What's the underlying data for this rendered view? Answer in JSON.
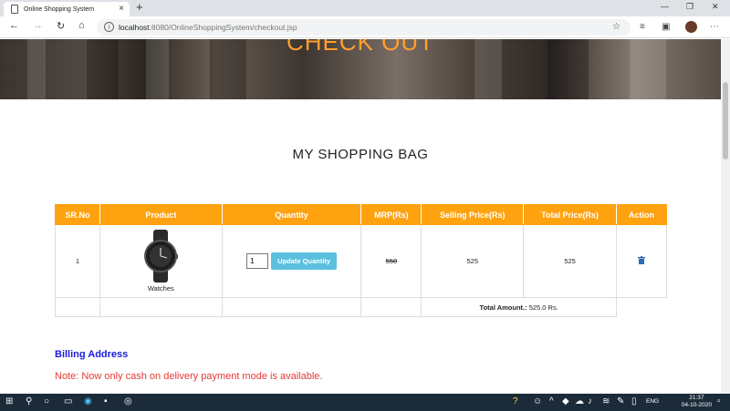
{
  "browser": {
    "tab_title": "Online Shopping System",
    "new_tab": "+",
    "close_tab": "×",
    "url_host": "localhost",
    "url_path": ":8080/OnlineShoppingSystem/checkout.jsp",
    "info_glyph": "i"
  },
  "hero": {
    "title": "CHECK OUT"
  },
  "bag": {
    "title": "MY SHOPPING BAG"
  },
  "table": {
    "headers": [
      "SR.No",
      "Product",
      "Quantity",
      "MRP(Rs)",
      "Selling Price(Rs)",
      "Total Price(Rs)",
      "Action"
    ],
    "rows": [
      {
        "sr": "1",
        "product": "Watches",
        "quantity": "1",
        "update_label": "Update Quantity",
        "mrp": "550",
        "selling": "525",
        "total": "525",
        "action_icon": "trash-icon"
      }
    ],
    "total_label": "Total Amount.:",
    "total_value": " 525.0 Rs."
  },
  "billing": {
    "title": "Billing Address",
    "note": "Note: Now only cash on delivery payment mode is available."
  },
  "taskbar": {
    "lang": "ENG",
    "time": "21:37",
    "date": "04-10-2020"
  },
  "colors": {
    "accent": "#ffa20f",
    "hero_title": "#ff9f2e",
    "button": "#5bc0de",
    "billing_title": "#1a1adb",
    "note": "#e53935",
    "trash": "#2f6db3"
  }
}
